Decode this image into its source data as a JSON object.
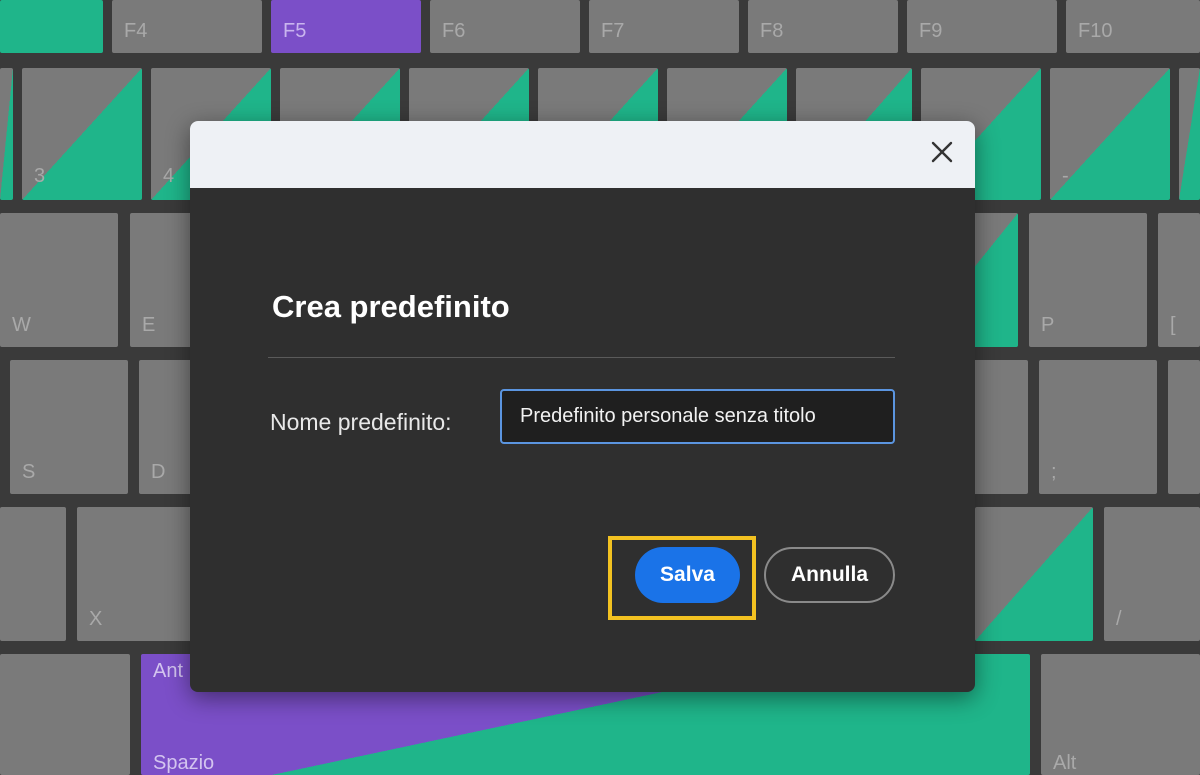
{
  "keyboard": {
    "fkeys": [
      "F4",
      "F5",
      "F6",
      "F7",
      "F8",
      "F9",
      "F10"
    ],
    "number_keys": [
      "3",
      "4",
      "-"
    ],
    "row_q": [
      "W",
      "E",
      "P",
      "["
    ],
    "row_a": [
      "S",
      "D",
      ";"
    ],
    "row_z": [
      "X",
      "/"
    ],
    "bottom": [
      "Spazio",
      "Alt"
    ],
    "partial_label": "Ant"
  },
  "dialog": {
    "title": "Crea predefinito",
    "field_label": "Nome predefinito:",
    "field_value": "Predefinito personale senza titolo",
    "save_label": "Salva",
    "cancel_label": "Annulla"
  },
  "colors": {
    "accent_blue": "#1a73e8",
    "highlight_yellow": "#f3c221",
    "key_green": "#1fb58a",
    "key_purple": "#7b4fc8"
  },
  "icons": {
    "close": "close-icon"
  }
}
